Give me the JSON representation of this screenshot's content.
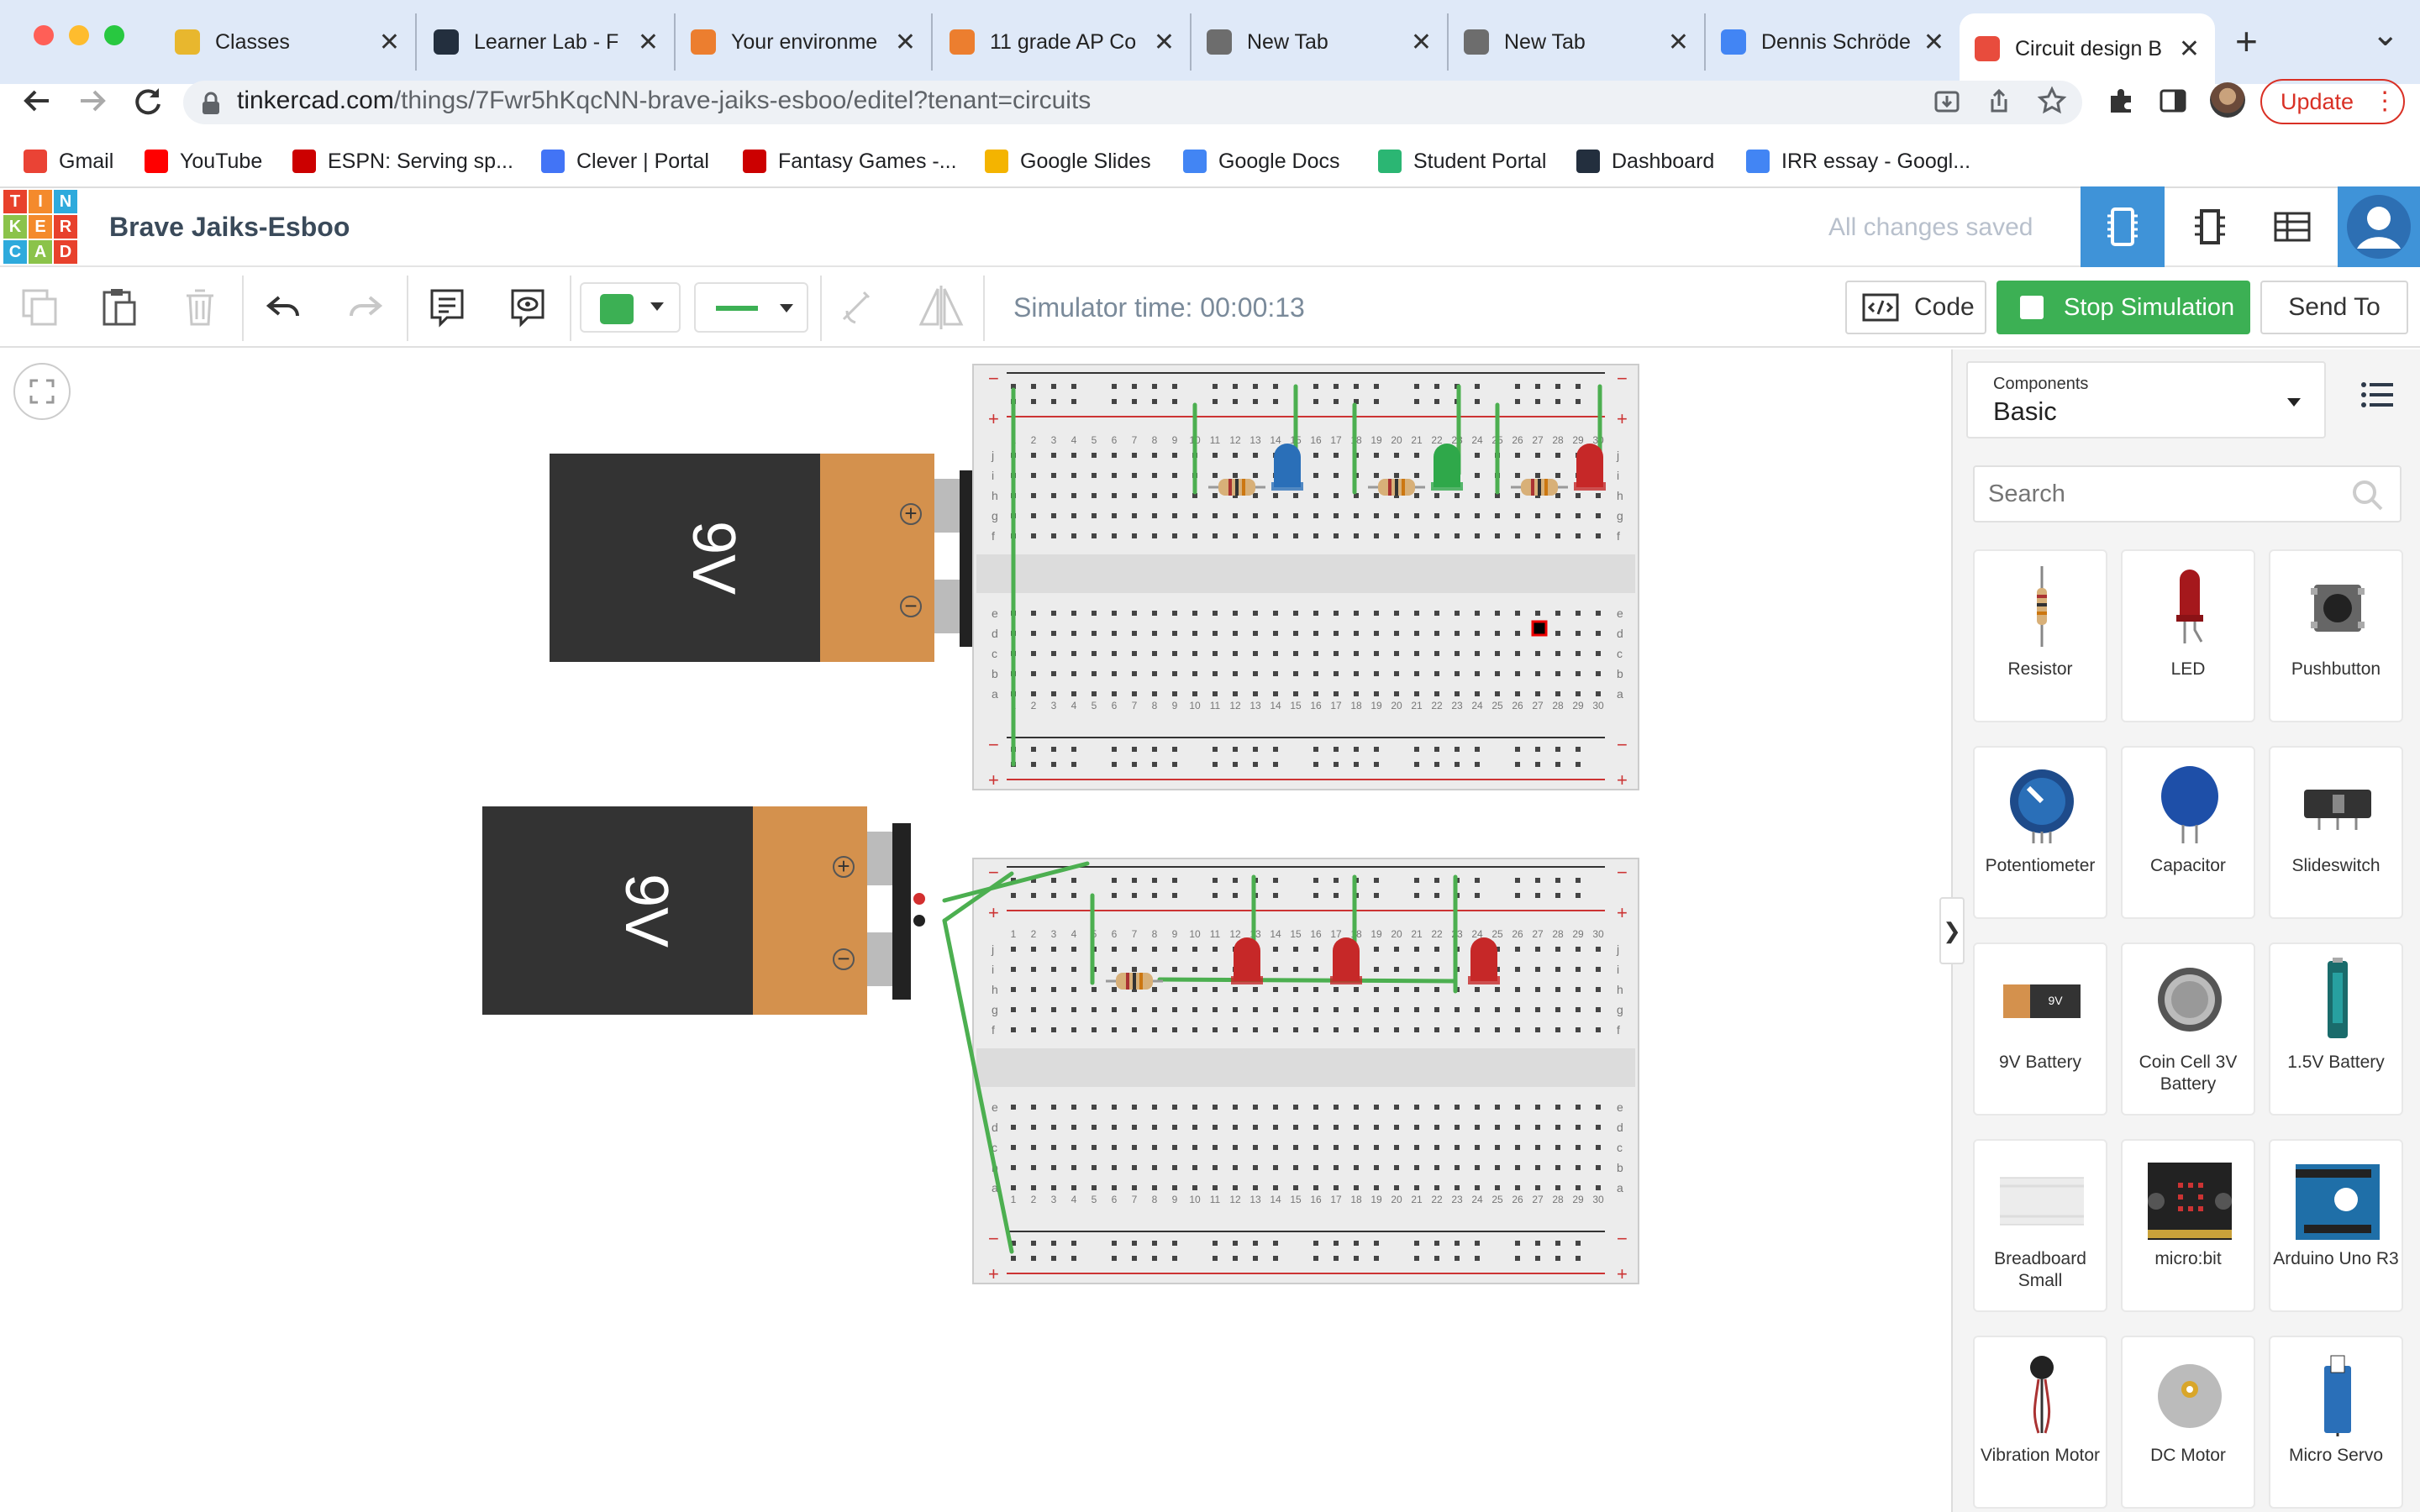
{
  "browser": {
    "tabs": [
      {
        "label": "Classes",
        "color": "#e8b72e"
      },
      {
        "label": "Learner Lab - F",
        "color": "#232f3e"
      },
      {
        "label": "Your environme",
        "color": "#ec7e2f"
      },
      {
        "label": "11 grade AP Co",
        "color": "#ec7e2f"
      },
      {
        "label": "New Tab",
        "color": "#6d6d6d"
      },
      {
        "label": "New Tab",
        "color": "#6d6d6d"
      },
      {
        "label": "Dennis Schröde",
        "color": "#4285f4"
      },
      {
        "label": "Circuit design B",
        "color": "#e84c3d"
      }
    ],
    "close_glyph": "✕",
    "new_tab_glyph": "+",
    "tab_list_glyph": "⌄",
    "url_host": "tinkercad.com",
    "url_path": "/things/7Fwr5hKqcNN-brave-jaiks-esboo/editel?tenant=circuits",
    "update_label": "Update",
    "bookmarks": [
      {
        "label": "Gmail",
        "color": "#ea4335"
      },
      {
        "label": "YouTube",
        "color": "#ff0000"
      },
      {
        "label": "ESPN: Serving sp...",
        "color": "#cc0000"
      },
      {
        "label": "Clever | Portal",
        "color": "#4274f6"
      },
      {
        "label": "Fantasy Games -...",
        "color": "#cc0000"
      },
      {
        "label": "Google Slides",
        "color": "#f4b400"
      },
      {
        "label": "Google Docs",
        "color": "#4285f4"
      },
      {
        "label": "Student Portal",
        "color": "#2bb673"
      },
      {
        "label": "Dashboard",
        "color": "#232f3e"
      },
      {
        "label": "IRR essay - Googl...",
        "color": "#4285f4"
      }
    ]
  },
  "app": {
    "logo_letters": [
      "T",
      "I",
      "N",
      "K",
      "E",
      "R",
      "C",
      "A",
      "D"
    ],
    "logo_colors": [
      "#e8412c",
      "#f48a2c",
      "#2eaadc",
      "#8bc34a",
      "#f48a2c",
      "#e8412c",
      "#2eaadc",
      "#8bc34a",
      "#e8412c"
    ],
    "project_title": "Brave Jaiks-Esboo",
    "save_status": "All changes saved"
  },
  "toolbar": {
    "simulator_time": "Simulator time: 00:00:13",
    "code_label": "Code",
    "stop_label": "Stop Simulation",
    "send_label": "Send To",
    "accent_green": "#3cb054",
    "accent_blue": "#3f93d8"
  },
  "sidebar": {
    "components_caption": "Components",
    "components_value": "Basic",
    "search_placeholder": "Search",
    "collapse_glyph": "❯",
    "items": [
      {
        "label": "Resistor",
        "icon": "resistor-icon"
      },
      {
        "label": "LED",
        "icon": "led-icon"
      },
      {
        "label": "Pushbutton",
        "icon": "pushbutton-icon"
      },
      {
        "label": "Potentiometer",
        "icon": "potentiometer-icon"
      },
      {
        "label": "Capacitor",
        "icon": "capacitor-icon"
      },
      {
        "label": "Slideswitch",
        "icon": "slideswitch-icon"
      },
      {
        "label": "9V Battery",
        "icon": "battery-9v-icon"
      },
      {
        "label": "Coin Cell 3V Battery",
        "icon": "coin-cell-icon"
      },
      {
        "label": "1.5V Battery",
        "icon": "battery-aa-icon"
      },
      {
        "label": "Breadboard Small",
        "icon": "breadboard-icon"
      },
      {
        "label": "micro:bit",
        "icon": "microbit-icon"
      },
      {
        "label": "Arduino Uno R3",
        "icon": "arduino-icon"
      },
      {
        "label": "Vibration Motor",
        "icon": "vibration-motor-icon"
      },
      {
        "label": "DC Motor",
        "icon": "dc-motor-icon"
      },
      {
        "label": "Micro Servo",
        "icon": "micro-servo-icon"
      }
    ]
  },
  "circuit": {
    "battery_label": "9V",
    "battery_plus": "+",
    "battery_minus": "−",
    "rail_plus": "+",
    "rail_minus": "−",
    "row_letters_top": [
      "j",
      "i",
      "h",
      "g",
      "f"
    ],
    "row_letters_bottom": [
      "e",
      "d",
      "c",
      "b",
      "a"
    ],
    "column_numbers": [
      "1",
      "2",
      "3",
      "4",
      "5",
      "6",
      "7",
      "8",
      "9",
      "10",
      "11",
      "12",
      "13",
      "14",
      "15",
      "16",
      "17",
      "18",
      "19",
      "20",
      "21",
      "22",
      "23",
      "24",
      "25",
      "26",
      "27",
      "28",
      "29",
      "30"
    ],
    "board1_led_colors": [
      "#2a6fb8",
      "#2fa84a",
      "#c62828"
    ],
    "board2_led_colors": [
      "#c62828",
      "#c62828",
      "#c62828"
    ]
  }
}
